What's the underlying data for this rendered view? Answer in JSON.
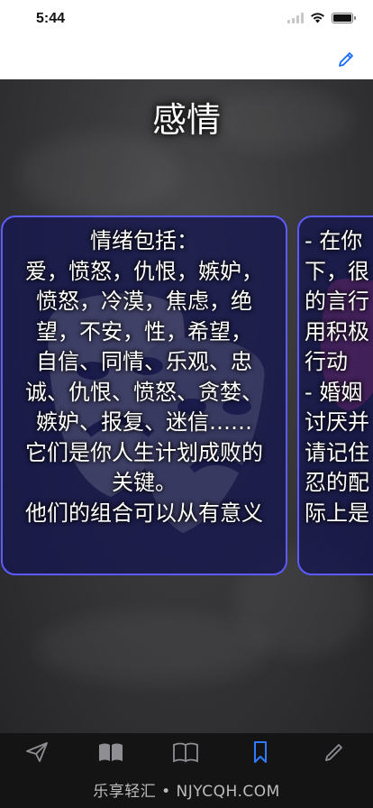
{
  "status_bar": {
    "time": "5:44"
  },
  "board": {
    "title": "感情"
  },
  "cards": [
    {
      "text": "情绪包括：\n爱，愤怒，仇恨，嫉妒，\n愤怒，冷漠，焦虑，绝\n望，不安，性，希望，\n自信、同情、乐观、忠\n诚、仇恨、愤怒、贪婪、\n嫉妒、报复、迷信……\n它们是你人生计划成败的\n关键。\n他们的组合可以从有意义"
    },
    {
      "text": "- 在你\n下，很\n的言行\n用积极\n  行动\n- 婚姻\n讨厌并\n请记住\n忍的配\n际上是"
    }
  ],
  "tab_bar": {
    "active_color": "#2f7bff",
    "inactive_color": "#8e8e93",
    "tabs": [
      "send-icon",
      "book-filled-icon",
      "book-open-icon",
      "bookmark-icon",
      "pencil-icon"
    ],
    "watermark": "乐享轻汇 • NJYCQH.COM"
  },
  "colors": {
    "card_border": "#5b5bff",
    "nav_accent": "#1a6cff"
  }
}
